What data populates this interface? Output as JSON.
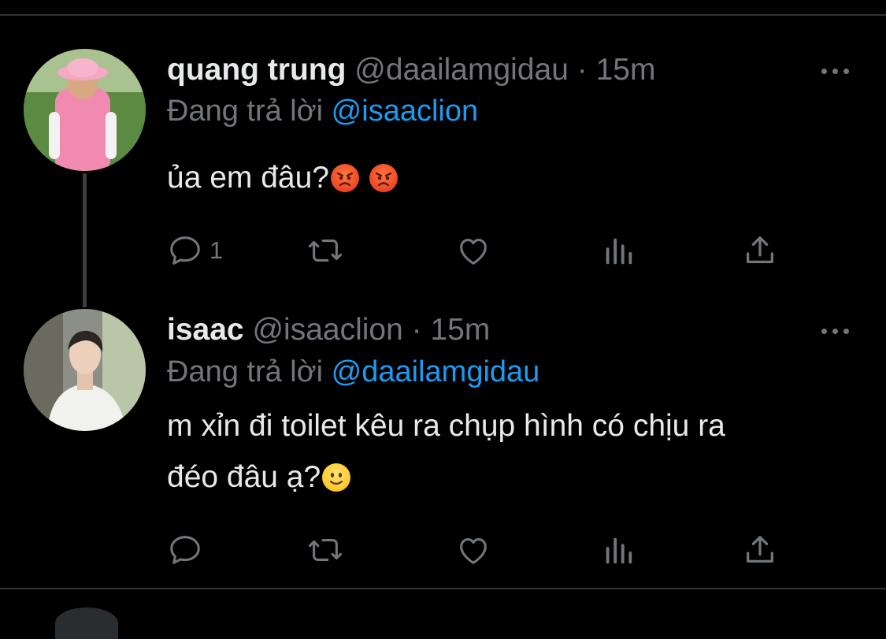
{
  "tweets": [
    {
      "name": "quang trung",
      "handle": "@daailamgidau",
      "separator": "·",
      "time": "15m",
      "reply_prefix": "Đang trả lời",
      "reply_to": "@isaaclion",
      "text_line1": "ủa em đâu?",
      "emojis": [
        "angry-face-emoji",
        "angry-face-emoji"
      ],
      "actions": {
        "reply_count": "1",
        "retweet_count": "",
        "like_count": ""
      }
    },
    {
      "name": "isaac",
      "handle": "@isaaclion",
      "separator": "·",
      "time": "15m",
      "reply_prefix": "Đang trả lời",
      "reply_to": "@daailamgidau",
      "text_line1": "m xỉn đi toilet kêu ra chụp hình có chịu ra",
      "text_line2": "đéo đâu ạ?",
      "emojis": [
        "slightly-smiling-face-emoji"
      ],
      "actions": {
        "reply_count": "",
        "retweet_count": "",
        "like_count": ""
      }
    }
  ],
  "colors": {
    "background": "#000000",
    "text": "#e7e9ea",
    "secondary": "#71767b",
    "accent": "#1d9bf0",
    "divider": "#2f3336"
  }
}
